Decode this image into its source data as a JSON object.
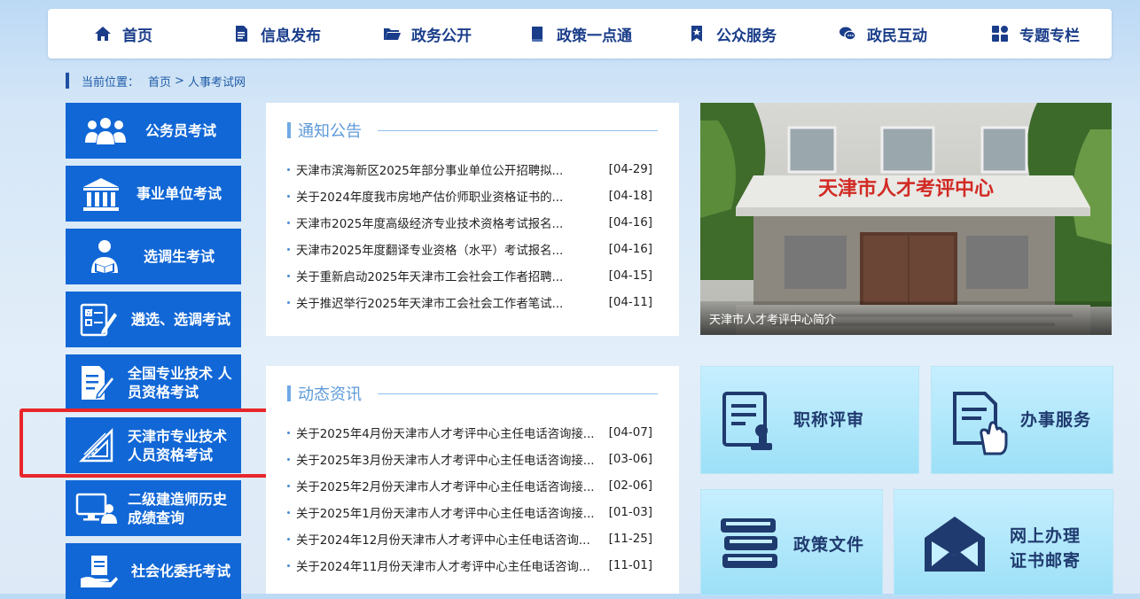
{
  "nav": {
    "items": [
      {
        "label": "首页",
        "icon": "home-icon"
      },
      {
        "label": "信息发布",
        "icon": "document-icon"
      },
      {
        "label": "政务公开",
        "icon": "folder-icon"
      },
      {
        "label": "政策一点通",
        "icon": "book-icon"
      },
      {
        "label": "公众服务",
        "icon": "bookmark-star-icon"
      },
      {
        "label": "政民互动",
        "icon": "chat-icon"
      },
      {
        "label": "专题专栏",
        "icon": "grid-icon"
      }
    ]
  },
  "breadcrumb": {
    "prefix": "当前位置：",
    "home": "首页",
    "separator": ">",
    "current": "人事考试网"
  },
  "left_menu": {
    "items": [
      {
        "label": "公务员考试",
        "icon": "people-group-icon"
      },
      {
        "label": "事业单位考试",
        "icon": "building-icon"
      },
      {
        "label": "选调生考试",
        "icon": "student-reading-icon"
      },
      {
        "label": "遴选、选调考试",
        "icon": "checklist-icon"
      },
      {
        "label_line1": "全国专业技术 人",
        "label_line2": "员资格考试",
        "icon": "exam-paper-icon"
      },
      {
        "label_line1": "天津市专业技术",
        "label_line2": "人员资格考试",
        "icon": "ruler-triangle-icon"
      },
      {
        "label_line1": "二级建造师历史",
        "label_line2": "成绩查询",
        "icon": "computer-user-icon"
      },
      {
        "label": "社会化委托考试",
        "icon": "hand-document-icon"
      }
    ]
  },
  "notice": {
    "title": "通知公告",
    "items": [
      {
        "title": "天津市滨海新区2025年部分事业单位公开招聘拟...",
        "date": "[04-29]"
      },
      {
        "title": "关于2024年度我市房地产估价师职业资格证书的...",
        "date": "[04-18]"
      },
      {
        "title": "天津市2025年度高级经济专业技术资格考试报名...",
        "date": "[04-16]"
      },
      {
        "title": "天津市2025年度翻译专业资格（水平）考试报名...",
        "date": "[04-16]"
      },
      {
        "title": "关于重新启动2025年天津市工会社会工作者招聘...",
        "date": "[04-15]"
      },
      {
        "title": "关于推迟举行2025年天津市工会社会工作者笔试...",
        "date": "[04-11]"
      }
    ]
  },
  "news": {
    "title": "动态资讯",
    "items": [
      {
        "title": "关于2025年4月份天津市人才考评中心主任电话咨询接...",
        "date": "[04-07]"
      },
      {
        "title": "关于2025年3月份天津市人才考评中心主任电话咨询接...",
        "date": "[03-06]"
      },
      {
        "title": "关于2025年2月份天津市人才考评中心主任电话咨询接...",
        "date": "[02-06]"
      },
      {
        "title": "关于2025年1月份天津市人才考评中心主任电话咨询接...",
        "date": "[01-03]"
      },
      {
        "title": "关于2024年12月份天津市人才考评中心主任电话咨询...",
        "date": "[11-25]"
      },
      {
        "title": "关于2024年11月份天津市人才考评中心主任电话咨询...",
        "date": "[11-01]"
      }
    ]
  },
  "photo": {
    "sign_text": "天津市人才考评中心",
    "caption": "天津市人才考评中心简介"
  },
  "tiles": {
    "title_review": "职称评审",
    "service": "办事服务",
    "policy": "政策文件",
    "mail_line1": "网上办理",
    "mail_line2": "证书邮寄"
  },
  "colors": {
    "nav_text": "#1a3d8a",
    "menu_bg": "#1167d6",
    "highlight": "#e8262a",
    "section_title": "#5d9ad8"
  }
}
